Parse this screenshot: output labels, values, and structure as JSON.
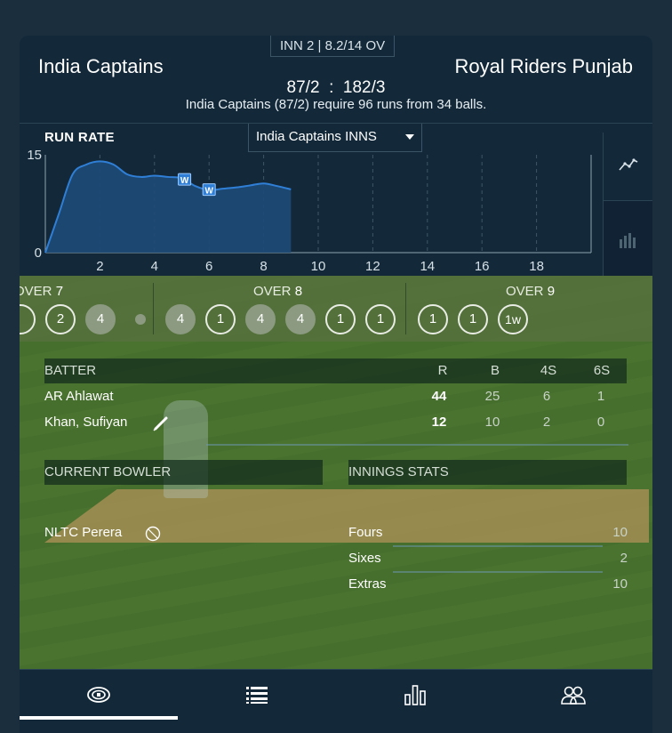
{
  "header": {
    "innings_info": "INN 2 | 8.2/14 OV",
    "team_left": "India Captains",
    "team_right": "Royal Riders Punjab",
    "score": "87/2  :  182/3",
    "requirement": "India Captains (87/2) require 96 runs from 34 balls."
  },
  "run_rate": {
    "title": "RUN RATE",
    "innings_select": "India Captains INNS",
    "side_tabs": {
      "line": "line-chart-icon",
      "bar": "bar-chart-icon"
    }
  },
  "chart_data": {
    "type": "area",
    "title": "RUN RATE",
    "x_ticks": [
      "2",
      "4",
      "6",
      "8",
      "10",
      "12",
      "14",
      "16",
      "18"
    ],
    "y_ticks": [
      "0",
      "15"
    ],
    "xlim": [
      0,
      20
    ],
    "ylim": [
      0,
      15
    ],
    "x": [
      0,
      0.5,
      1,
      1.5,
      2,
      2.5,
      3,
      3.5,
      4,
      4.5,
      5,
      5.5,
      6,
      6.5,
      7,
      7.5,
      8,
      8.5,
      9
    ],
    "y": [
      0,
      6,
      12,
      13.5,
      14,
      13.5,
      12,
      11.6,
      11.8,
      11.6,
      11.4,
      10.2,
      9.6,
      9.8,
      10.0,
      10.3,
      10.6,
      10.2,
      9.7
    ],
    "wickets": [
      {
        "x": 5.1,
        "label": "W"
      },
      {
        "x": 6.0,
        "label": "W"
      }
    ],
    "grid": "vertical dashed",
    "series_color": "#2f7fd6"
  },
  "overs": [
    {
      "label": "OVER",
      "num": "7",
      "balls": [
        {
          "v": "",
          "t": "outline"
        },
        {
          "v": "2",
          "t": "outline"
        },
        {
          "v": "4",
          "t": "filled"
        },
        {
          "v": "",
          "t": "dot"
        }
      ]
    },
    {
      "label": "OVER",
      "num": "8",
      "balls": [
        {
          "v": "4",
          "t": "filled"
        },
        {
          "v": "1",
          "t": "outline"
        },
        {
          "v": "4",
          "t": "filled"
        },
        {
          "v": "4",
          "t": "filled"
        },
        {
          "v": "1",
          "t": "outline"
        },
        {
          "v": "1",
          "t": "outline"
        }
      ]
    },
    {
      "label": "OVER",
      "num": "9",
      "balls": [
        {
          "v": "1",
          "t": "outline"
        },
        {
          "v": "1",
          "t": "outline"
        },
        {
          "v": "1w",
          "t": "outline"
        }
      ]
    }
  ],
  "batting": {
    "headers": {
      "batter": "BATTER",
      "r": "R",
      "b": "B",
      "fours": "4S",
      "sixes": "6S"
    },
    "rows": [
      {
        "name": "AR Ahlawat",
        "r": "44",
        "b": "25",
        "fours": "6",
        "sixes": "1",
        "on_strike": false
      },
      {
        "name": "Khan, Sufiyan",
        "r": "12",
        "b": "10",
        "fours": "2",
        "sixes": "0",
        "on_strike": true
      }
    ]
  },
  "bowling": {
    "header": "CURRENT BOWLER",
    "bowler": "NLTC Perera"
  },
  "innings_stats": {
    "header": "INNINGS STATS",
    "rows": [
      {
        "label": "Fours",
        "value": "10"
      },
      {
        "label": "Sixes",
        "value": "2"
      },
      {
        "label": "Extras",
        "value": "10"
      }
    ]
  },
  "nav": {
    "items": [
      "field-view-icon",
      "list-icon",
      "stats-bar-icon",
      "players-icon"
    ],
    "active": 0
  },
  "colors": {
    "background": "#13293a",
    "accent": "#2f7fd6",
    "field": "#4f7a32"
  }
}
